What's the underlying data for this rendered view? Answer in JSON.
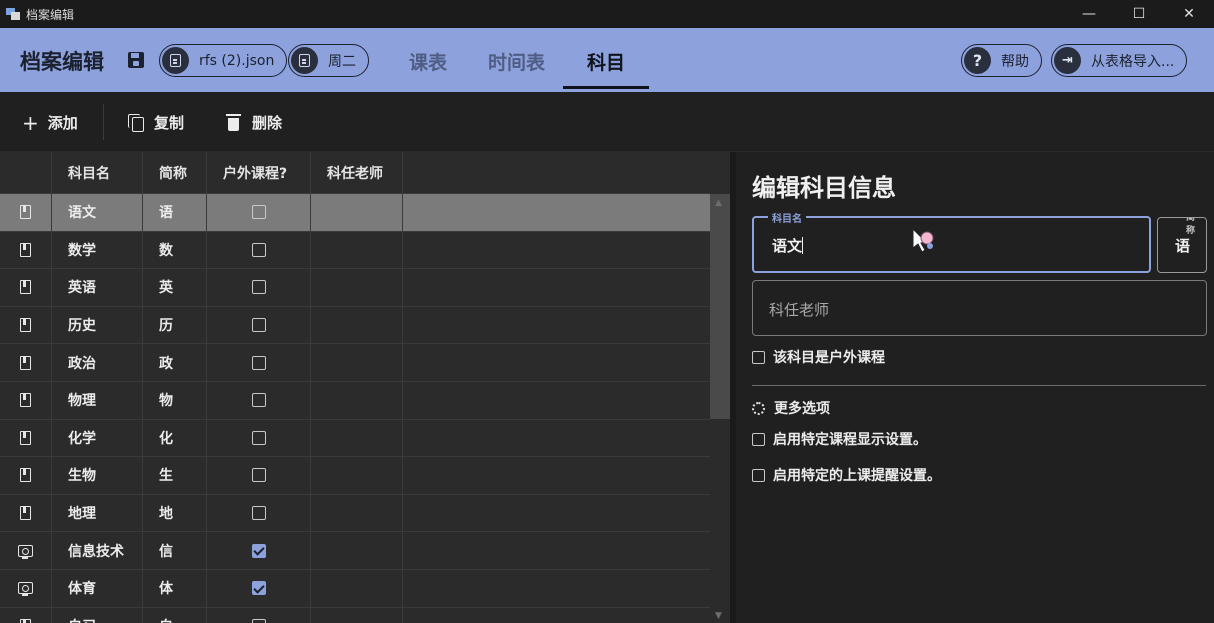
{
  "window": {
    "title": "档案编辑",
    "controls": [
      "—",
      "☐",
      "✕"
    ]
  },
  "header": {
    "app_title": "档案编辑",
    "file_chip": "rfs (2).json",
    "day_chip": "周二",
    "tabs": [
      {
        "label": "课表",
        "active": false
      },
      {
        "label": "时间表",
        "active": false
      },
      {
        "label": "科目",
        "active": true
      }
    ],
    "help_icon": "?",
    "help_label": "帮助",
    "import_label": "从表格导入..."
  },
  "toolbar": {
    "add_label": "添加",
    "copy_label": "复制",
    "delete_label": "删除"
  },
  "table": {
    "columns": [
      "科目名",
      "简称",
      "户外课程?",
      "科任老师"
    ],
    "rows": [
      {
        "name": "语文",
        "short": "语",
        "outdoor": false,
        "teacher": "",
        "icon": "book-icon",
        "selected": true
      },
      {
        "name": "数学",
        "short": "数",
        "outdoor": false,
        "teacher": "",
        "icon": "book-icon"
      },
      {
        "name": "英语",
        "short": "英",
        "outdoor": false,
        "teacher": "",
        "icon": "book-icon"
      },
      {
        "name": "历史",
        "short": "历",
        "outdoor": false,
        "teacher": "",
        "icon": "book-icon"
      },
      {
        "name": "政治",
        "short": "政",
        "outdoor": false,
        "teacher": "",
        "icon": "book-icon"
      },
      {
        "name": "物理",
        "short": "物",
        "outdoor": false,
        "teacher": "",
        "icon": "book-icon"
      },
      {
        "name": "化学",
        "short": "化",
        "outdoor": false,
        "teacher": "",
        "icon": "book-icon"
      },
      {
        "name": "生物",
        "short": "生",
        "outdoor": false,
        "teacher": "",
        "icon": "book-icon"
      },
      {
        "name": "地理",
        "short": "地",
        "outdoor": false,
        "teacher": "",
        "icon": "book-icon"
      },
      {
        "name": "信息技术",
        "short": "信",
        "outdoor": true,
        "teacher": "",
        "icon": "monitor-icon"
      },
      {
        "name": "体育",
        "short": "体",
        "outdoor": true,
        "teacher": "",
        "icon": "monitor-icon"
      },
      {
        "name": "自习",
        "short": "自",
        "outdoor": false,
        "teacher": "",
        "icon": "book-icon"
      }
    ]
  },
  "editor": {
    "title": "编辑科目信息",
    "name_label": "科目名",
    "name_value": "语文",
    "short_label": "简称",
    "short_value": "语",
    "teacher_placeholder": "科任老师",
    "outdoor_label": "该科目是户外课程",
    "more_options_label": "更多选项",
    "display_settings_label": "启用特定课程显示设置。",
    "reminder_settings_label": "启用特定的上课提醒设置。"
  },
  "colors": {
    "accent": "#8da2dc",
    "header_bg": "#8da2dc",
    "selected_row": "#7b7b7b",
    "background": "#202020"
  }
}
